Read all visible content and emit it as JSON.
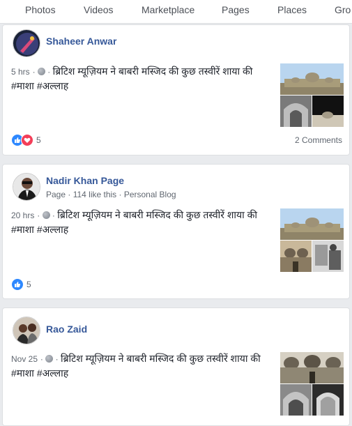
{
  "tabs": [
    "Photos",
    "Videos",
    "Marketplace",
    "Pages",
    "Places",
    "Gro"
  ],
  "posts": [
    {
      "author": "Shaheer Anwar",
      "subline": "",
      "time": "5 hrs",
      "text": "ब्रिटिश म्यूज़ियम ने बाबरी मस्जिद की कुछ तस्वीरें शाया की #माशा #अल्लाह",
      "reaction_count": "5",
      "comments": "2 Comments",
      "reactions": [
        "like-icon",
        "love-icon"
      ]
    },
    {
      "author": "Nadir Khan Page",
      "subline": "Page · 114 like this · Personal Blog",
      "time": "20 hrs",
      "text": "ब्रिटिश म्यूज़ियम ने बाबरी मस्जिद की कुछ तस्वीरें शाया की #माशा #अल्लाह",
      "reaction_count": "5",
      "comments": "",
      "reactions": [
        "like-icon"
      ]
    },
    {
      "author": "Rao Zaid",
      "subline": "",
      "time": "Nov 25",
      "text": "ब्रिटिश म्यूज़ियम ने बाबरी मस्जिद की कुछ तस्वीरें शाया की #माशा #अल्लाह",
      "reaction_count": "",
      "comments": "",
      "reactions": []
    }
  ],
  "colors": {
    "link": "#365899",
    "like": "#2d88ff",
    "love": "#f33e58",
    "background": "#e9ebee"
  }
}
